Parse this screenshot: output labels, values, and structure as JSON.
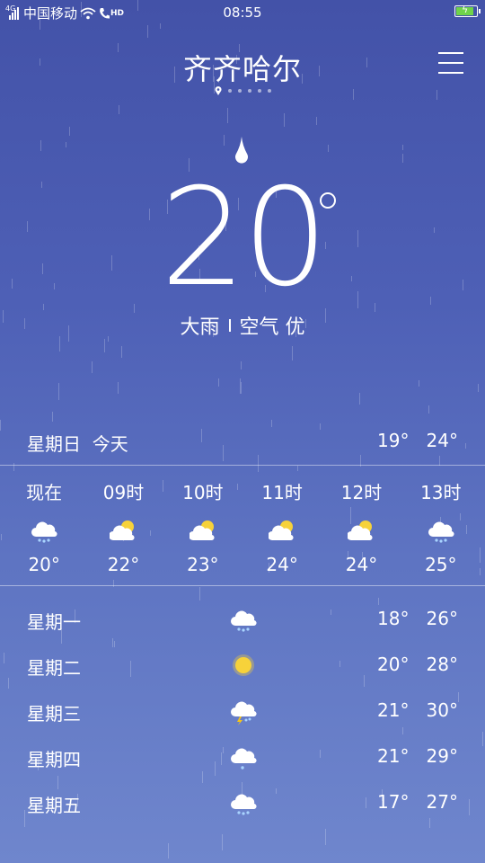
{
  "status_bar": {
    "network_type": "4G",
    "carrier": "中国移动",
    "hd_label": "HD",
    "time": "08:55",
    "battery_color": "#6fd34a"
  },
  "header": {
    "city": "齐齐哈尔",
    "page_count": 6,
    "menu_icon": "hamburger-menu-icon"
  },
  "current": {
    "drop_icon": "raindrop-icon",
    "temperature": "20",
    "condition": "大雨",
    "air_quality": "空气 优"
  },
  "today": {
    "label": "星期日  今天",
    "range": "19°   24°"
  },
  "hourly": [
    {
      "time": "现在",
      "icon": "rain-cloud",
      "temp": "20°"
    },
    {
      "time": "09时",
      "icon": "partly-cloudy",
      "temp": "22°"
    },
    {
      "time": "10时",
      "icon": "partly-cloudy",
      "temp": "23°"
    },
    {
      "time": "11时",
      "icon": "partly-cloudy",
      "temp": "24°"
    },
    {
      "time": "12时",
      "icon": "partly-cloudy",
      "temp": "24°"
    },
    {
      "time": "13时",
      "icon": "rain-cloud",
      "temp": "25°"
    }
  ],
  "daily": [
    {
      "day": "星期一",
      "icon": "rain-cloud",
      "range": "18°   26°"
    },
    {
      "day": "星期二",
      "icon": "sun",
      "range": "20°   28°"
    },
    {
      "day": "星期三",
      "icon": "thunder-cloud",
      "range": "21°   30°"
    },
    {
      "day": "星期四",
      "icon": "light-rain-cloud",
      "range": "21°   29°"
    },
    {
      "day": "星期五",
      "icon": "rain-cloud",
      "range": "17°   27°"
    }
  ],
  "colors": {
    "sun": "#f7d23a",
    "bolt": "#f5c518",
    "cloud": "#ffffff",
    "rain": "#a9d4ff"
  }
}
